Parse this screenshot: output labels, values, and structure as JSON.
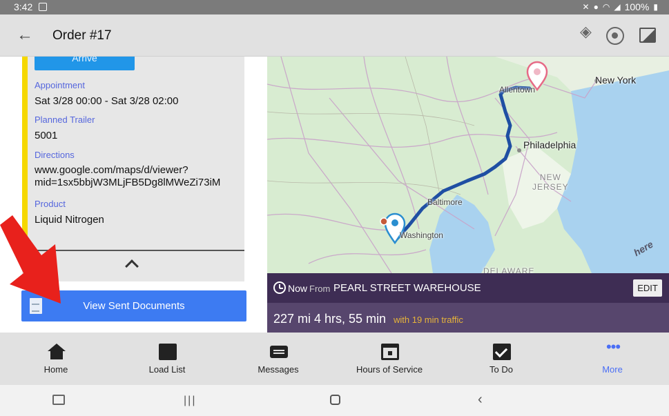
{
  "status_bar": {
    "time": "3:42",
    "battery": "100%",
    "icons": [
      "mute-icon",
      "location-icon",
      "wifi-icon",
      "signal-icon",
      "battery-icon"
    ]
  },
  "app_bar": {
    "title": "Order #17",
    "actions": [
      "layers-icon",
      "target-icon",
      "image-icon"
    ]
  },
  "order": {
    "arrive_label": "Arrive",
    "fields": [
      {
        "label": "Appointment",
        "value": "Sat 3/28 00:00 - Sat 3/28 02:00"
      },
      {
        "label": "Planned Trailer",
        "value": "5001"
      },
      {
        "label": "Directions",
        "value": "www.google.com/maps/d/viewer?\nmid=1sx5bbjW3MLjFB5Dg8lMWeZi73iM"
      },
      {
        "label": "Product",
        "value": "Liquid Nitrogen"
      }
    ],
    "view_docs_label": "View Sent Documents"
  },
  "map": {
    "cities": {
      "new_york": "New York",
      "philadelphia": "Philadelphia",
      "baltimore": "Baltimore",
      "washington": "Washington",
      "allentown": "Allentown",
      "new_jersey": "NEW\nJERSEY",
      "delaware": "DELAWARE"
    },
    "provider": "here"
  },
  "route": {
    "now": "Now",
    "from": "From",
    "origin": "PEARL STREET WAREHOUSE",
    "edit_label": "EDIT",
    "summary": "227 mi 4 hrs, 55 min",
    "traffic": "with 19 min traffic"
  },
  "bottom_nav": {
    "items": [
      {
        "label": "Home",
        "icon": "home-icon"
      },
      {
        "label": "Load List",
        "icon": "box-icon"
      },
      {
        "label": "Messages",
        "icon": "message-icon"
      },
      {
        "label": "Hours of Service",
        "icon": "calendar-icon"
      },
      {
        "label": "To Do",
        "icon": "checkbox-icon"
      },
      {
        "label": "More",
        "icon": "more-dots-icon"
      }
    ],
    "active": "More"
  },
  "colors": {
    "accent": "#3d7bf2",
    "highlight": "#f5d800",
    "route_bar": "#3e2d54",
    "traffic": "#e7b43a"
  }
}
